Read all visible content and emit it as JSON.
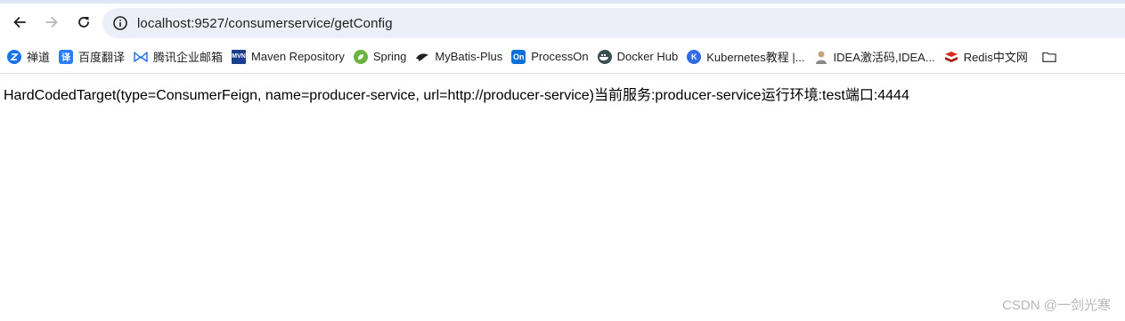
{
  "browser": {
    "address_bar": {
      "url": "localhost:9527/consumerservice/getConfig"
    },
    "nav_icons": [
      "back-arrow-icon",
      "forward-arrow-icon",
      "reload-icon",
      "site-info-icon"
    ],
    "bookmarks": [
      {
        "label": "禅道",
        "icon": "zentao-icon",
        "color": "#1a73e8"
      },
      {
        "label": "百度翻译",
        "icon": "baidu-translate-icon",
        "color": "#2b7cff"
      },
      {
        "label": "腾讯企业邮箱",
        "icon": "tencent-mail-icon",
        "color": "#1e6fe0"
      },
      {
        "label": "Maven Repository",
        "icon": "maven-icon",
        "color": "#1c3f8c"
      },
      {
        "label": "Spring",
        "icon": "spring-leaf-icon",
        "color": "#6db33f"
      },
      {
        "label": "MyBatis-Plus",
        "icon": "mybatis-bird-icon",
        "color": "#222222"
      },
      {
        "label": "ProcessOn",
        "icon": "processon-icon",
        "color": "#0a6fd6"
      },
      {
        "label": "Docker Hub",
        "icon": "docker-icon",
        "color": "#1d63ed"
      },
      {
        "label": "Kubernetes教程 |...",
        "icon": "kubernetes-icon",
        "color": "#326ce5"
      },
      {
        "label": "IDEA激活码,IDEA...",
        "icon": "idea-avatar-icon",
        "color": "#b0b0b0"
      },
      {
        "label": "Redis中文网",
        "icon": "redis-icon",
        "color": "#d82c20"
      },
      {
        "label": "",
        "icon": "folder-icon",
        "color": "#444444"
      }
    ]
  },
  "page": {
    "body_text": "HardCodedTarget(type=ConsumerFeign, name=producer-service, url=http://producer-service)当前服务:producer-service运行环境:test端口:4444",
    "watermark": "CSDN @一剑光寒"
  }
}
